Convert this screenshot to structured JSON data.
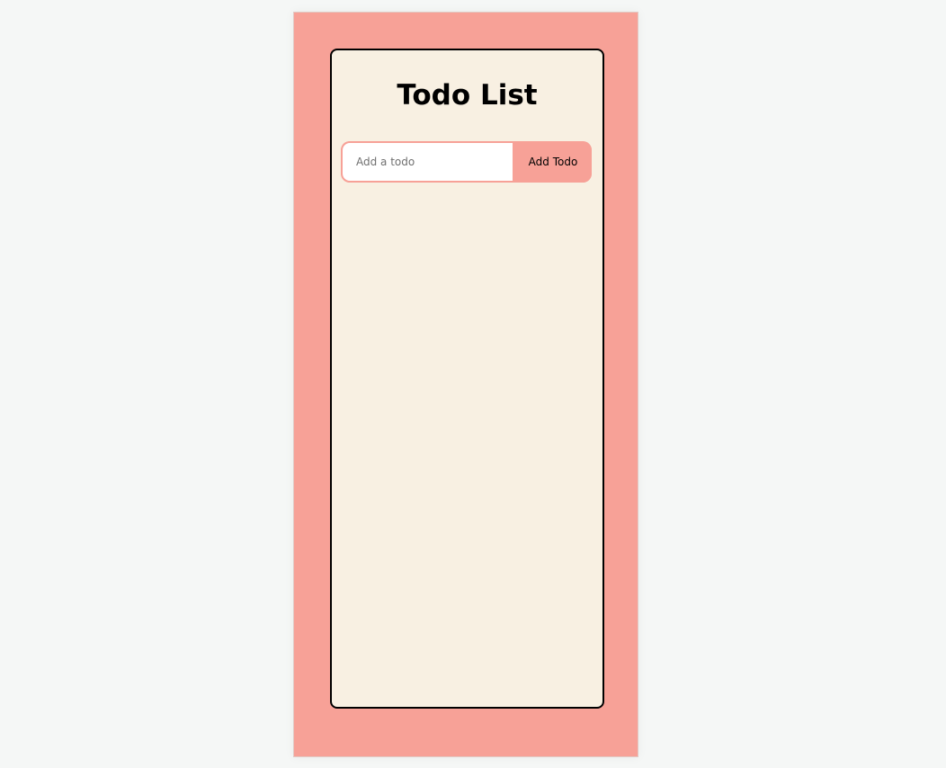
{
  "app": {
    "title": "Todo List"
  },
  "add_form": {
    "input_value": "",
    "input_placeholder": "Add a todo",
    "button_label": "Add Todo"
  },
  "todos": [],
  "colors": {
    "page_background": "#f5f7f6",
    "frame_background": "#f7a197",
    "card_background": "#f8f0e2",
    "card_border": "#000000",
    "input_background": "#ffffff",
    "accent": "#f7a197"
  }
}
